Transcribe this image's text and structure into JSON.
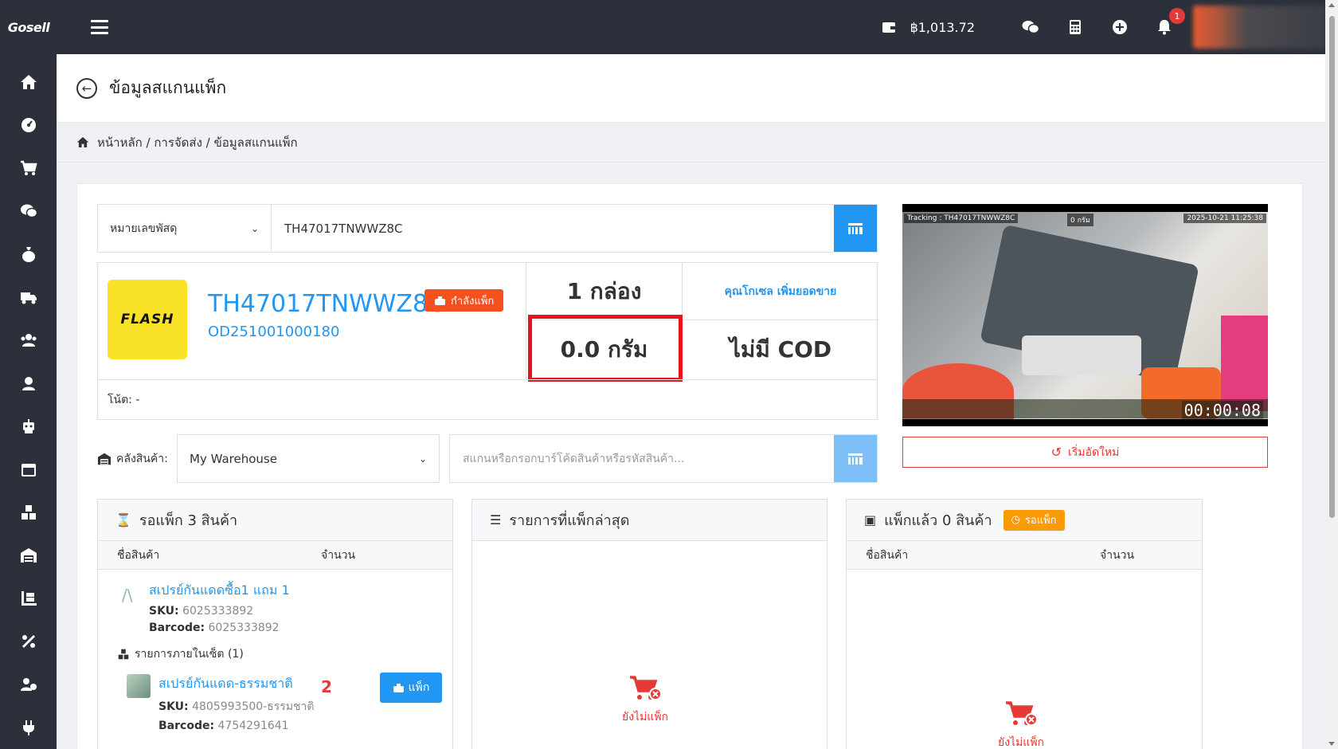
{
  "topbar": {
    "brand": "Gosell",
    "balance": "฿1,013.72",
    "notification_count": "1"
  },
  "page": {
    "title": "ข้อมูลสแกนแพ็ก",
    "breadcrumb": "หน้าหลัก / การจัดส่ง / ข้อมูลสแกนแพ็ก"
  },
  "search": {
    "type_selected": "หมายเลขพัสดุ",
    "value": "TH47017TNWWZ8C"
  },
  "parcel": {
    "carrier_logo_text": "FLASH",
    "tracking": "TH47017TNWWZ8C",
    "status_badge": "กำลังแพ็ก",
    "order_no": "OD251001000180",
    "boxes": "1 กล่อง",
    "upsell_link": "คุณโกเซล เพิ่มยอดขาย",
    "weight": "0.0 กรัม",
    "cod": "ไม่มี COD",
    "note": "โน้ต: -"
  },
  "warehouse": {
    "label": "คลังสินค้า:",
    "selected": "My Warehouse",
    "barcode_placeholder": "สแกนหรือกรอกบาร์โค้ดสินค้าหรือรหัสสินค้า..."
  },
  "video": {
    "overlay_tracking": "Tracking : TH47017TNWWZ8C",
    "overlay_weight": "0 กรัม",
    "overlay_datetime": "2025-10-21 11:25:38",
    "timer": "00:00:08",
    "restart_label": "เริ่มอัดใหม่"
  },
  "waiting_panel": {
    "title": "รอแพ็ก 3 สินค้า",
    "col_name": "ชื่อสินค้า",
    "col_qty": "จำนวน",
    "item": {
      "name": "สเปรย์กันแดดซื้อ1 แถม 1",
      "sku_label": "SKU:",
      "sku": "6025333892",
      "barcode_label": "Barcode:",
      "barcode": "6025333892"
    },
    "set_label": "รายการภายในเซ็ต (1)",
    "sub_item": {
      "name": "สเปรย์กันแดด-ธรรมชาติ",
      "qty": "2",
      "sku_label": "SKU:",
      "sku": "4805993500-ธรรมชาติ",
      "barcode_label": "Barcode:",
      "barcode": "4754291641"
    },
    "pack_button": "แพ็ก"
  },
  "recent_panel": {
    "title": "รายการที่แพ็กล่าสุด",
    "empty_text": "ยังไม่แพ็ก"
  },
  "packed_panel": {
    "title": "แพ็กแล้ว 0 สินค้า",
    "badge": "รอแพ็ก",
    "col_name": "ชื่อสินค้า",
    "col_qty": "จำนวน",
    "empty_text": "ยังไม่แพ็ก"
  },
  "colors": {
    "primary": "#2196f3",
    "danger": "#e53935",
    "warning": "#fb9a07",
    "sidebar": "#2b303b"
  }
}
